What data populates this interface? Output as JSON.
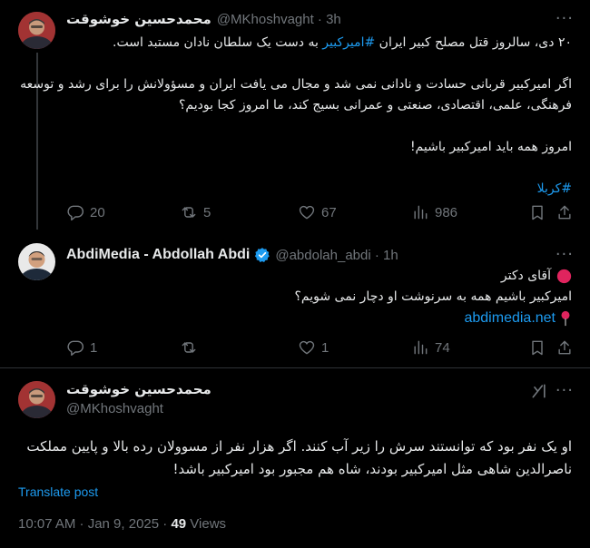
{
  "tweet1": {
    "author_name": "محمدحسین خوشوقت",
    "handle_time": "@MKhoshvaght · 3h",
    "line1_part1": "۲۰ دی، سالروز قتل مصلح کبیر ایران ",
    "line1_hashtag": "#امیرکبیر",
    "line1_part2": " به دست یک سلطان نادان مستبد است.",
    "line2": "اگر امیرکبیر قربانی حسادت و نادانی نمی شد و مجال می یافت ایران و مسؤولانش را برای رشد و توسعه",
    "line3": "فرهنگی، علمی، اقتصادی، صنعتی و عمرانی بسیج کند، ما امروز کجا بودیم؟",
    "line4": "امروز همه باید امیرکبیر باشیم!",
    "hashtag_line": "#کربلا",
    "replies": "20",
    "reposts": "5",
    "likes": "67",
    "views": "986"
  },
  "tweet2": {
    "author_name": "AbdiMedia - Abdollah Abdi",
    "handle_time": "@abdolah_abdi · 1h",
    "line1": "آقای دکتر",
    "line2": "امیرکبیر باشیم همه به سرنوشت او دچار نمی شویم؟",
    "link": "abdimedia.net",
    "replies": "1",
    "reposts": "",
    "likes": "1",
    "views": "74"
  },
  "tweet3": {
    "author_name": "محمدحسین خوشوقت",
    "handle": "@MKhoshvaght",
    "line1": "او یک نفر بود که توانستند سرش را زیر آب کنند. اگر هزار نفر از مسوولان رده بالا و پایین مملکت",
    "line2": "ناصرالدین شاهی مثل امیرکبیر بودند، شاه هم مجبور بود امیرکبیر باشد!",
    "translate": "Translate post",
    "time": "10:07 AM · Jan 9, 2025 · ",
    "views_count": "49",
    "views_label": " Views"
  },
  "more_label": "···",
  "icons": {
    "reply": "reply-icon",
    "repost": "repost-icon",
    "like": "like-icon",
    "views": "views-icon",
    "bookmark": "bookmark-icon",
    "share": "share-icon",
    "grok": "grok-icon",
    "verified": "verified-badge-icon",
    "red_circle": "red-circle-icon",
    "pin": "pin-icon"
  },
  "colors": {
    "link": "#1d9bf0",
    "verified": "#1d9bf0",
    "muted": "#71767b",
    "text": "#e7e9ea",
    "background": "#000000"
  }
}
